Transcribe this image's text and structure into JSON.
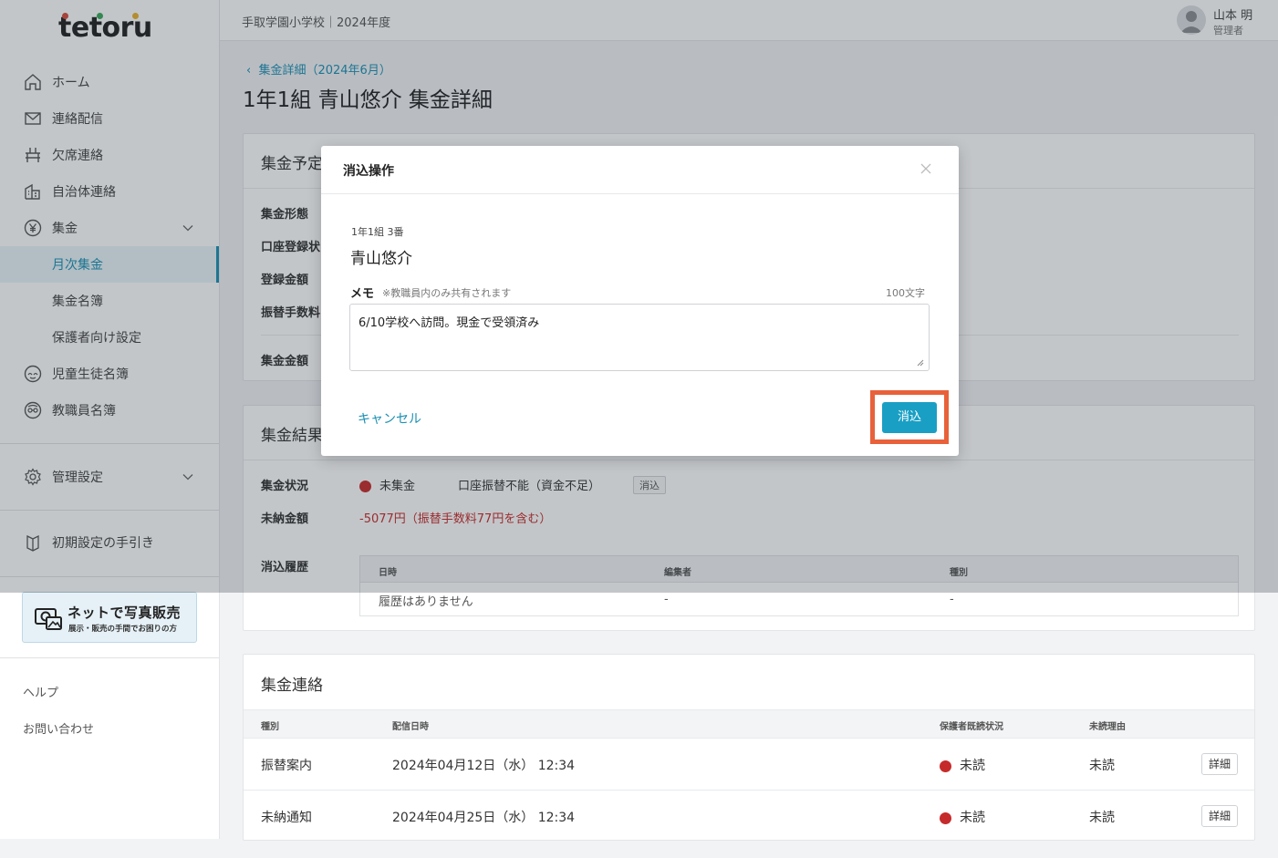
{
  "app": {
    "logo": "tetoru",
    "school": "手取学園小学校｜2024年度"
  },
  "user": {
    "name": "山本 明",
    "role": "管理者"
  },
  "sidebar": {
    "items": [
      {
        "label": "ホーム",
        "icon": "home-icon"
      },
      {
        "label": "連絡配信",
        "icon": "mail-icon"
      },
      {
        "label": "欠席連絡",
        "icon": "desk-icon"
      },
      {
        "label": "自治体連絡",
        "icon": "building-icon"
      },
      {
        "label": "集金",
        "icon": "yen-icon"
      },
      {
        "label": "月次集金"
      },
      {
        "label": "集金名簿"
      },
      {
        "label": "保護者向け設定"
      },
      {
        "label": "児童生徒名簿",
        "icon": "student-icon"
      },
      {
        "label": "教職員名簿",
        "icon": "teacher-icon"
      },
      {
        "label": "管理設定",
        "icon": "gear-icon"
      },
      {
        "label": "初期設定の手引き",
        "icon": "guide-icon"
      }
    ],
    "banner": {
      "title": "ネットで写真販売",
      "sub": "展示・販売の手間でお困りの方"
    },
    "help": "ヘルプ",
    "contact": "お問い合わせ"
  },
  "page": {
    "breadcrumb": "集金詳細（2024年6月）",
    "title": "1年1組 青山悠介 集金詳細"
  },
  "plan": {
    "title": "集金予定",
    "rows": [
      "集金形態",
      "口座登録状",
      "登録金額",
      "振替手数料",
      "集金金額"
    ]
  },
  "result": {
    "title": "集金結果",
    "status_label": "集金状況",
    "status_value": "未集金",
    "status_detail": "口座振替不能（資金不足）",
    "clear_tag": "消込",
    "unpaid_label": "未納金額",
    "unpaid_value": "-5077円（振替手数料77円を含む）",
    "history_label": "消込履歴",
    "history_headers": [
      "日時",
      "編集者",
      "種別"
    ],
    "history_row": [
      "履歴はありません",
      "-",
      "-"
    ]
  },
  "contacts": {
    "title": "集金連絡",
    "headers": [
      "種別",
      "配信日時",
      "保護者既読状況",
      "未読理由"
    ],
    "rows": [
      {
        "type": "振替案内",
        "date": "2024年04月12日（水） 12:34",
        "read": "未読",
        "reason": "未読",
        "btn": "詳細"
      },
      {
        "type": "未納通知",
        "date": "2024年04月25日（水） 12:34",
        "read": "未読",
        "reason": "未読",
        "btn": "詳細"
      }
    ]
  },
  "modal": {
    "title": "消込操作",
    "class_no": "1年1組 3番",
    "name": "青山悠介",
    "memo_label": "メモ",
    "memo_note": "※教職員内のみ共有されます",
    "memo_count": "100文字",
    "memo_value": "6/10学校へ訪問。現金で受領済み",
    "cancel": "キャンセル",
    "confirm": "消込"
  },
  "colors": {
    "accent": "#1a9fc4",
    "status_red": "#c62b2b",
    "highlight": "#e8613a"
  }
}
